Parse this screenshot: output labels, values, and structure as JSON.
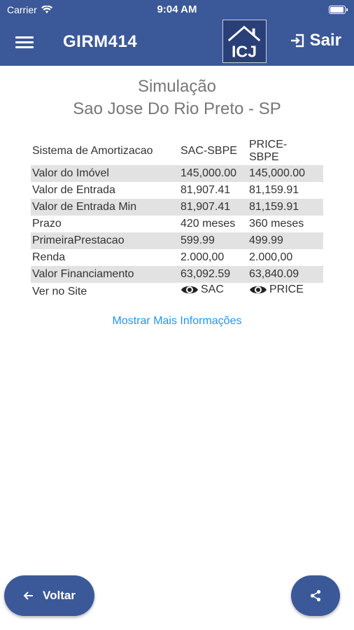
{
  "status_bar": {
    "carrier": "Carrier",
    "time": "9:04 AM",
    "battery_level": 1.0
  },
  "app_bar": {
    "title": "GIRM414",
    "logo_text": "ICJ",
    "logout_label": "Sair",
    "color": "#3b5998"
  },
  "heading": {
    "line1": "Simulação",
    "line2": "Sao Jose Do Rio Preto - SP"
  },
  "table": {
    "header": [
      "Sistema de Amortizacao",
      "SAC-SBPE",
      "PRICE-\nSBPE"
    ],
    "rows": [
      [
        "Valor do Imóvel",
        "145,000.00",
        "145,000.00"
      ],
      [
        "Valor de Entrada",
        "81,907.41",
        "81,159.91"
      ],
      [
        "Valor de Entrada Min",
        "81,907.41",
        "81,159.91"
      ],
      [
        "Prazo",
        "420 meses",
        "360 meses"
      ],
      [
        "PrimeiraPrestacao",
        "599.99",
        "499.99"
      ],
      [
        "Renda",
        "2.000,00",
        "2.000,00"
      ],
      [
        "Valor Financiamento",
        "63,092.59",
        "63,840.09"
      ]
    ],
    "site_row": {
      "label": "Ver no Site",
      "sac": "SAC",
      "price": "PRICE"
    }
  },
  "more_info_label": "Mostrar Mais Informações",
  "back_button_label": "Voltar",
  "icons": {
    "menu": "menu-icon",
    "logout": "logout-icon",
    "eye": "eye-icon",
    "back": "arrow-left-icon",
    "share": "share-icon",
    "wifi": "wifi-icon",
    "battery": "battery-icon"
  },
  "colors": {
    "primary": "#3b5998",
    "link": "#2196f3",
    "row_shade": "#e2e2e2"
  }
}
